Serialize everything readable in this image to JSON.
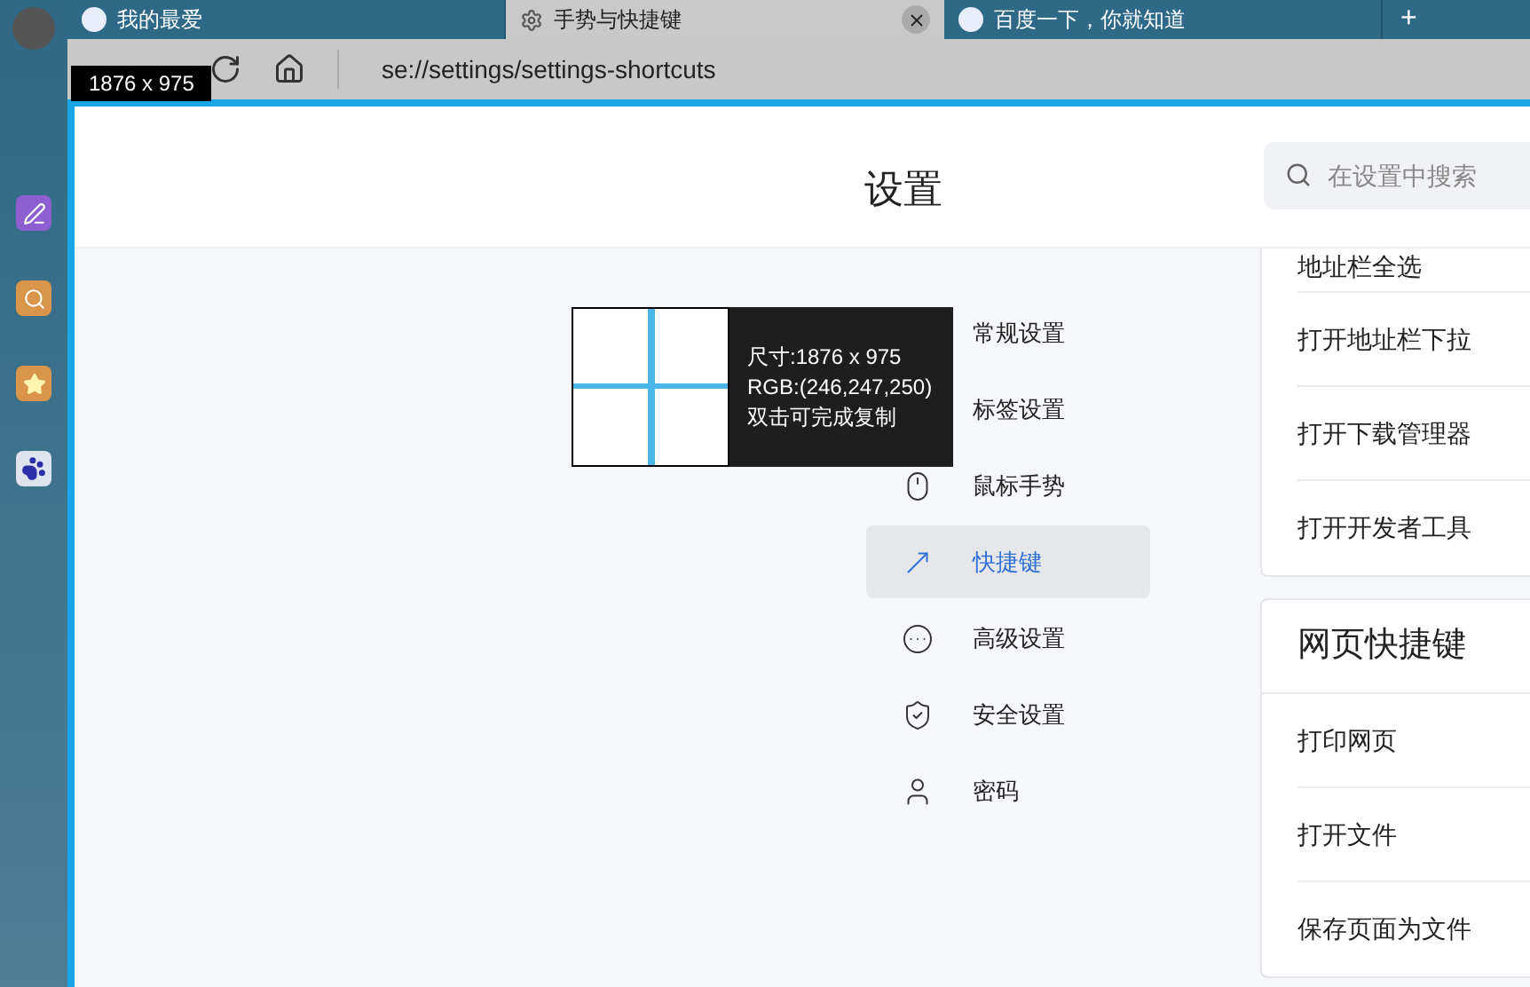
{
  "browser_tabs": [
    {
      "title": "我的最爱",
      "selected": false
    },
    {
      "title": "手势与快捷键",
      "selected": true
    },
    {
      "title": "百度一下，你就知道",
      "selected": false
    }
  ],
  "new_tab": "+",
  "address_bar": {
    "url": "se://settings/settings-shortcuts"
  },
  "header": {
    "title": "设置",
    "search": {
      "placeholder": "在设置中搜索"
    }
  },
  "settings_nav": [
    {
      "label": "常规设置",
      "selected": false
    },
    {
      "label": "标签设置",
      "selected": false
    },
    {
      "label": "鼠标手势",
      "selected": false
    },
    {
      "label": "快捷键",
      "selected": true
    },
    {
      "label": "高级设置",
      "selected": false
    },
    {
      "label": "安全设置",
      "selected": false
    },
    {
      "label": "密码",
      "selected": false
    }
  ],
  "shortcut_groups": [
    {
      "rows": [
        "地址栏全选",
        "打开地址栏下拉",
        "打开下载管理器",
        "打开开发者工具"
      ]
    },
    {
      "title": "网页快捷键",
      "rows": [
        "打印网页",
        "打开文件",
        "保存页面为文件"
      ]
    }
  ],
  "screen_ruler": {
    "size_label": "1876 x 975",
    "info": [
      "尺寸:1876 x 975",
      "RGB:(246,247,250)",
      "双击可完成复制"
    ]
  }
}
